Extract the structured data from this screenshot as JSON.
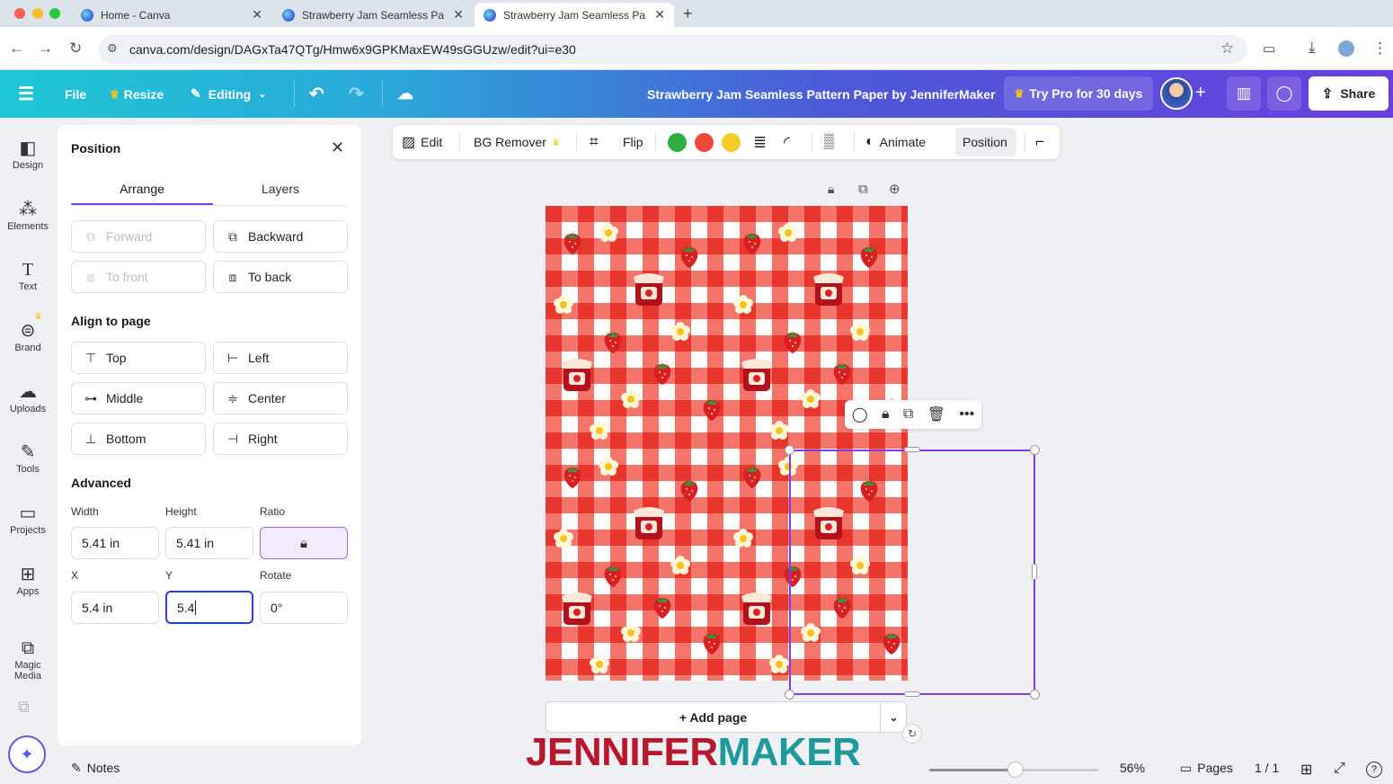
{
  "browser": {
    "tabs": [
      {
        "title": "Home - Canva"
      },
      {
        "title": "Strawberry Jam Seamless Pa"
      },
      {
        "title": "Strawberry Jam Seamless Pa"
      }
    ],
    "url": "canva.com/design/DAGxTa47QTg/Hmw6x9GPKMaxEW49sGGUzw/edit?ui=e30"
  },
  "header": {
    "file": "File",
    "resize": "Resize",
    "editing": "Editing",
    "doc_title": "Strawberry Jam Seamless Pattern Paper by JenniferMaker",
    "try_pro": "Try Pro for 30 days",
    "share": "Share",
    "colors": {
      "crown": "#f5c518"
    }
  },
  "sidebar": {
    "items": [
      {
        "label": "Design",
        "icon": "design-icon"
      },
      {
        "label": "Elements",
        "icon": "elements-icon"
      },
      {
        "label": "Text",
        "icon": "text-icon"
      },
      {
        "label": "Brand",
        "icon": "brand-icon"
      },
      {
        "label": "Uploads",
        "icon": "uploads-icon"
      },
      {
        "label": "Tools",
        "icon": "tools-icon"
      },
      {
        "label": "Projects",
        "icon": "projects-icon"
      },
      {
        "label": "Apps",
        "icon": "apps-icon"
      },
      {
        "label": "Magic Media",
        "icon": "magic-media-icon"
      }
    ]
  },
  "panel": {
    "title": "Position",
    "tabs": [
      "Arrange",
      "Layers"
    ],
    "active_tab": "Arrange",
    "arrange": {
      "forward": "Forward",
      "backward": "Backward",
      "to_front": "To front",
      "to_back": "To back"
    },
    "align_heading": "Align to page",
    "align": {
      "top": "Top",
      "left": "Left",
      "middle": "Middle",
      "center": "Center",
      "bottom": "Bottom",
      "right": "Right"
    },
    "advanced_heading": "Advanced",
    "width_label": "Width",
    "height_label": "Height",
    "ratio_label": "Ratio",
    "width_value": "5.41 in",
    "height_value": "5.41 in",
    "x_label": "X",
    "y_label": "Y",
    "rotate_label": "Rotate",
    "x_value": "5.4 in",
    "y_value": "5.4",
    "rotate_value": "0°"
  },
  "toolbar": {
    "edit": "Edit",
    "bg_remover": "BG Remover",
    "flip": "Flip",
    "colors": [
      "#2eae3f",
      "#f0473c",
      "#f5cc2a"
    ],
    "animate": "Animate",
    "position": "Position"
  },
  "canvas": {
    "add_page": "+ Add page",
    "accent": "#7b3fe4"
  },
  "footer": {
    "notes": "Notes",
    "zoom": "56%",
    "pages": "Pages",
    "page_count": "1 / 1",
    "zoom_level": 0.56
  },
  "watermark": {
    "part1": "JENNIFER",
    "part2": "MAKER",
    "color1": "#b8182e",
    "color2": "#1f9a9c"
  }
}
